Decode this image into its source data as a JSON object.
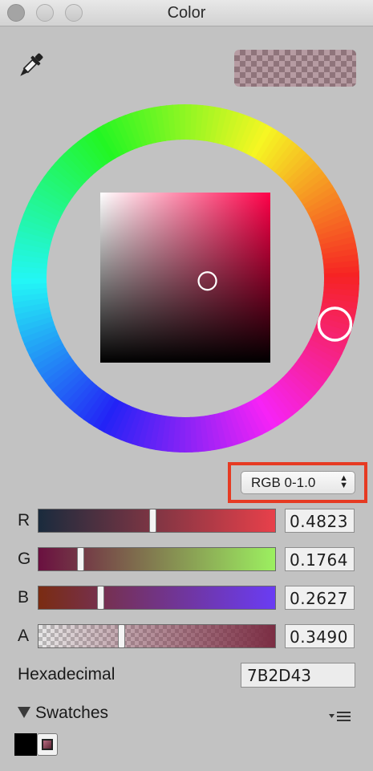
{
  "window": {
    "title": "Color"
  },
  "current_color": {
    "hex": "#7B2D43",
    "alpha": 0.349
  },
  "wheel": {
    "hue_degrees": 343,
    "saturation": 0.63,
    "value": 0.48
  },
  "color_model": {
    "selected": "RGB 0-1.0"
  },
  "channels": [
    {
      "label": "R",
      "value": "0.4823",
      "fraction": 0.4823,
      "gradient_from": "#1a2b3d",
      "gradient_to": "#e8404a"
    },
    {
      "label": "G",
      "value": "0.1764",
      "fraction": 0.1764,
      "gradient_from": "#6a1040",
      "gradient_to": "#9cf060"
    },
    {
      "label": "B",
      "value": "0.2627",
      "fraction": 0.2627,
      "gradient_from": "#7a2c12",
      "gradient_to": "#6a3cf4"
    },
    {
      "label": "A",
      "value": "0.3490",
      "fraction": 0.349,
      "gradient_from": "rgba(123,45,67,0)",
      "gradient_to": "#7b2d43"
    }
  ],
  "hexadecimal": {
    "label": "Hexadecimal",
    "value": "7B2D43"
  },
  "swatches": {
    "label": "Swatches",
    "items": [
      {
        "color": "#000000"
      }
    ]
  },
  "icons": {
    "eyedropper": "eyedropper-icon",
    "disclosure": "disclosure-triangle-icon",
    "swatch_menu": "menu-icon",
    "select_arrows": "updown-arrows-icon"
  }
}
